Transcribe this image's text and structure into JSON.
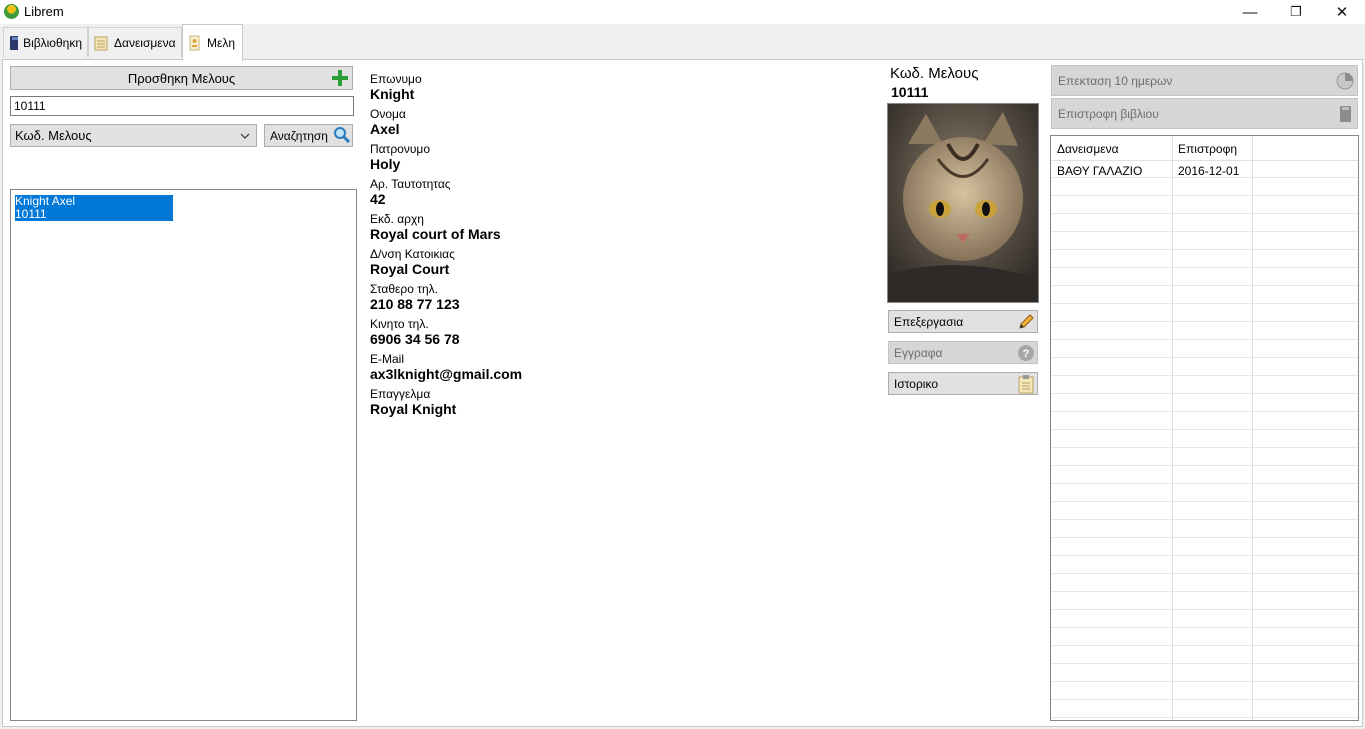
{
  "window": {
    "title": "Librem",
    "minimize": "—",
    "restore": "❐",
    "close": "✕"
  },
  "tabs": [
    {
      "label": "Βιβλιοθηκη"
    },
    {
      "label": "Δανεισμενα"
    },
    {
      "label": "Μελη"
    }
  ],
  "left": {
    "add_member_label": "Προσθηκη Μελους",
    "search_value": "10111",
    "search_field": "Κωδ. Μελους",
    "search_button": "Αναζητηση",
    "results": [
      {
        "name": "Knight Axel",
        "code": "10111"
      }
    ]
  },
  "details": [
    {
      "label": "Επωνυμο",
      "value": "Knight"
    },
    {
      "label": "Ονομα",
      "value": "Axel"
    },
    {
      "label": "Πατρονυμο",
      "value": "Holy"
    },
    {
      "label": "Αρ. Ταυτοτητας",
      "value": "42"
    },
    {
      "label": "Εκδ. αρχη",
      "value": "Royal court of Mars"
    },
    {
      "label": "Δ/νση Κατοικιας",
      "value": "Royal Court"
    },
    {
      "label": "Σταθερο τηλ.",
      "value": "210 88 77 123"
    },
    {
      "label": "Κινητο τηλ.",
      "value": "6906 34 56 78"
    },
    {
      "label": "E-Mail",
      "value": "ax3lknight@gmail.com"
    },
    {
      "label": "Επαγγελμα",
      "value": "Royal Knight"
    }
  ],
  "member": {
    "code_label": "Κωδ. Μελους",
    "code_value": "10111",
    "edit_label": "Επεξεργασια",
    "docs_label": "Εγγραφα",
    "history_label": "Ιστορικο"
  },
  "right": {
    "extend_label": "Επεκταση 10 ημερων",
    "return_label": "Επιστροφη βιβλιου",
    "columns": [
      "Δανεισμενα",
      "Επιστροφη"
    ],
    "rows": [
      {
        "book": "ΒΑΘΥ ΓΑΛΑΖΙΟ",
        "return_date": "2016-12-01"
      }
    ]
  },
  "colors": {
    "selection": "#0078d7",
    "add_icon": "#2e9e36"
  }
}
